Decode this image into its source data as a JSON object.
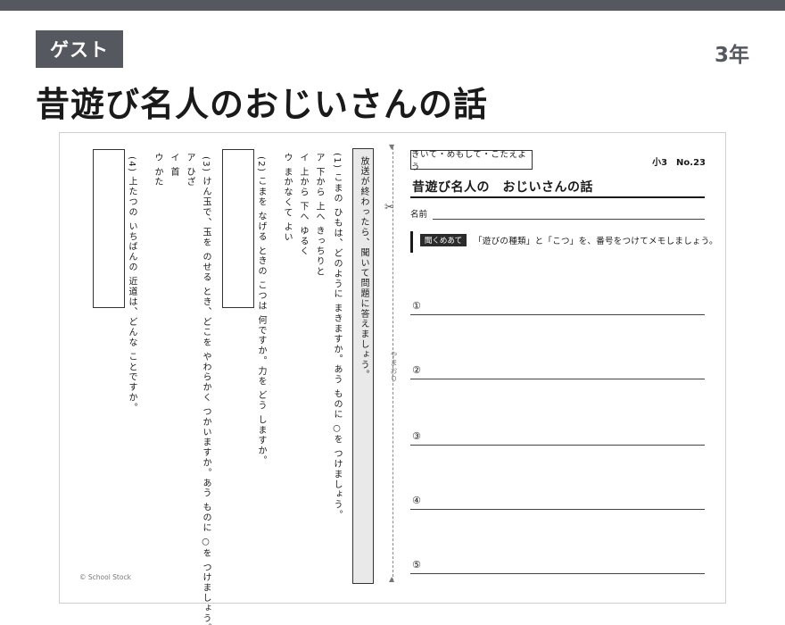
{
  "header": {
    "badge": "ゲスト",
    "grade": "3年",
    "title": "昔遊び名人のおじいさんの話"
  },
  "sheet": {
    "instruction": "放送が終わったら、聞いて問題に答えましょう。",
    "q1": {
      "question": "(1) こまの ひもは、どのように まきますか。あう ものに ○を つけましょう。",
      "options": [
        "ア 下から 上へ きっちりと",
        "イ 上から 下へ ゆるく",
        "ウ まかなくて よい"
      ]
    },
    "q2": {
      "question": "(2) こまを なげる ときの こつは 何ですか。力を どう しますか。"
    },
    "q3": {
      "question": "(3) けん玉で、玉を のせる とき、どこを やわらかく つかいますか。あう ものに ○を つけましょう。",
      "options": [
        "ア ひざ",
        "イ 首",
        "ウ かた"
      ]
    },
    "q4": {
      "question": "(4) 上たつの いちばんの 近道は、どんな ことですか。"
    },
    "fold": {
      "label": "やまおり",
      "top_mark": "▼",
      "bottom_mark": "▲",
      "scissor": "✂"
    },
    "memo": {
      "tag": "きいて・めもして・こたえよう",
      "number": "小3　No.23",
      "title": "昔遊び名人の　おじいさんの話",
      "name_label": "名前",
      "chip": "聞くめあて",
      "task": "「遊びの種類」と「こつ」を、番号をつけてメモしましょう。",
      "items": [
        "①",
        "②",
        "③",
        "④",
        "⑤"
      ]
    },
    "copyright": "© School Stock"
  }
}
